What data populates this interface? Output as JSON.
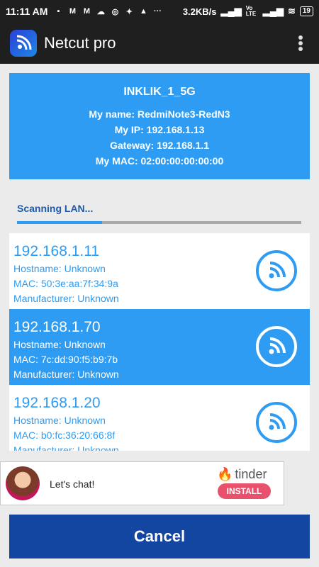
{
  "status_bar": {
    "time": "11:11 AM",
    "dots": "···",
    "speed": "3.2KB/s",
    "network": "Vo LTE",
    "battery": "19"
  },
  "app_bar": {
    "title": "Netcut pro"
  },
  "network_info": {
    "ssid": "INKLIK_1_5G",
    "my_name": "My name: RedmiNote3-RedN3",
    "my_ip": "My IP: 192.168.1.13",
    "gateway": "Gateway: 192.168.1.1",
    "my_mac": "My MAC: 02:00:00:00:00:00"
  },
  "scan": {
    "label": "Scanning LAN...",
    "progress": 0.3
  },
  "devices": [
    {
      "ip": "192.168.1.11",
      "hostname": "Hostname: Unknown",
      "mac": "MAC: 50:3e:aa:7f:34:9a",
      "manufacturer": "Manufacturer: Unknown",
      "selected": false
    },
    {
      "ip": "192.168.1.70",
      "hostname": "Hostname: Unknown",
      "mac": "MAC: 7c:dd:90:f5:b9:7b",
      "manufacturer": "Manufacturer: Unknown",
      "selected": true
    },
    {
      "ip": "192.168.1.20",
      "hostname": "Hostname: Unknown",
      "mac": "MAC: b0:fc:36:20:66:8f",
      "manufacturer": "Manufacturer: Unknown",
      "selected": false
    }
  ],
  "ad": {
    "text": "Let's chat!",
    "brand": "tinder",
    "button": "INSTALL"
  },
  "cancel_label": "Cancel",
  "colors": {
    "accent": "#2d9cf2",
    "cancel": "#1346a0",
    "install": "#e9506c"
  }
}
